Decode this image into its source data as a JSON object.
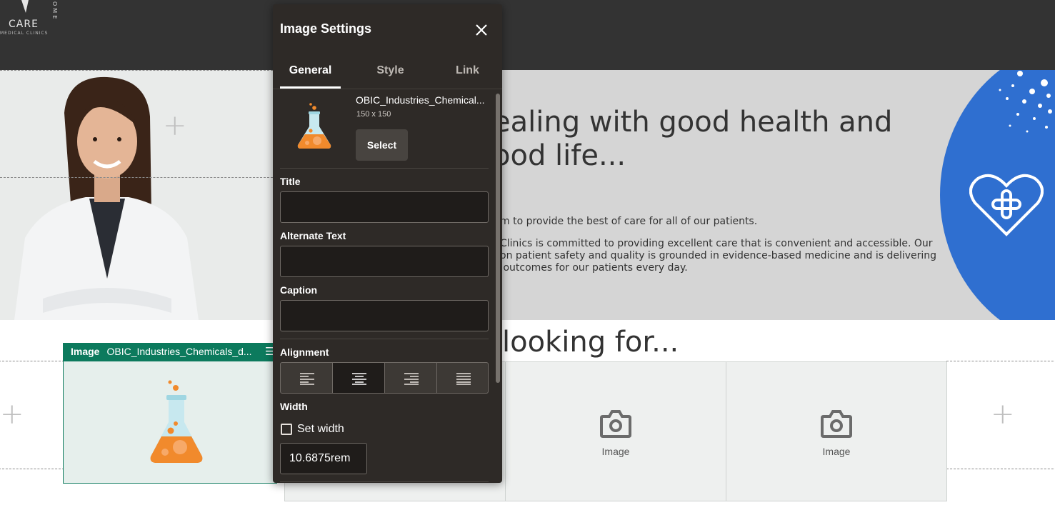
{
  "logo": {
    "name": "CARE",
    "subtitle": "MEDICAL CLINICS",
    "arc_text": "OME"
  },
  "hero": {
    "title_line1": "ealing with good health and",
    "title_line2": "ood life...",
    "para1": "m to provide the best of care for all of our patients.",
    "para2_line1": "Clinics is committed to providing excellent care that is convenient and accessible. Our",
    "para2_line2": "on patient safety and quality is grounded in evidence-based medicine and is delivering",
    "para2_line3": " outcomes for our patients every day."
  },
  "section": {
    "title": "looking for..."
  },
  "selected_component": {
    "type_label": "Image",
    "file_label": "OBIC_Industries_Chemicals_d..."
  },
  "tiles": [
    {
      "label": "Image"
    },
    {
      "label": "Image"
    }
  ],
  "dialog": {
    "title": "Image Settings",
    "tabs": [
      {
        "label": "General",
        "active": true
      },
      {
        "label": "Style",
        "active": false
      },
      {
        "label": "Link",
        "active": false
      }
    ],
    "image": {
      "file_name": "OBIC_Industries_Chemical...",
      "dimensions": "150 x 150",
      "select_label": "Select"
    },
    "fields": {
      "title": {
        "label": "Title",
        "value": ""
      },
      "alt_text": {
        "label": "Alternate Text",
        "value": ""
      },
      "caption": {
        "label": "Caption",
        "value": ""
      }
    },
    "alignment": {
      "label": "Alignment",
      "options": [
        "align-left",
        "align-center",
        "align-right",
        "justify"
      ],
      "selected": "align-center"
    },
    "width": {
      "label": "Width",
      "set_width_label": "Set width",
      "set_width_checked": false,
      "value": "10.6875rem"
    }
  },
  "colors": {
    "accent": "#0c7a5d",
    "dialog_bg": "#2e2a27",
    "hero_blue": "#2f6fd0",
    "header_bg": "#333333"
  }
}
